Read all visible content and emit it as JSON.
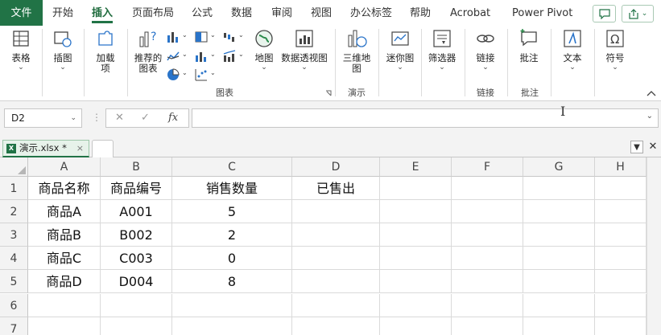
{
  "menu": {
    "file": "文件",
    "tabs": [
      "开始",
      "插入",
      "页面布局",
      "公式",
      "数据",
      "审阅",
      "视图",
      "办公标签",
      "帮助",
      "Acrobat",
      "Power Pivot"
    ],
    "active_tab": "插入"
  },
  "ribbon": {
    "table": "表格",
    "illustrations": "插图",
    "addins": "加载\n项",
    "recommended_charts": "推荐的\n图表",
    "maps": "地图",
    "pivot_chart": "数据透视图",
    "charts_group": "图表",
    "3d_map": "三维地\n图",
    "tours_group": "演示",
    "sparklines": "迷你图",
    "filters": "筛选器",
    "link": "链接",
    "links_group": "链接",
    "comment": "批注",
    "comments_group": "批注",
    "text": "文本",
    "symbols": "符号"
  },
  "formula_bar": {
    "name_box": "D2",
    "formula": ""
  },
  "workbook": {
    "tab_name": "演示.xlsx *"
  },
  "columns": [
    "A",
    "B",
    "C",
    "D",
    "E",
    "F",
    "G",
    "H"
  ],
  "rows": [
    "1",
    "2",
    "3",
    "4",
    "5",
    "6",
    "7"
  ],
  "cells": [
    [
      "商品名称",
      "商品编号",
      "销售数量",
      "已售出",
      "",
      "",
      "",
      ""
    ],
    [
      "商品A",
      "A001",
      "5",
      "",
      "",
      "",
      "",
      ""
    ],
    [
      "商品B",
      "B002",
      "2",
      "",
      "",
      "",
      "",
      ""
    ],
    [
      "商品C",
      "C003",
      "0",
      "",
      "",
      "",
      "",
      ""
    ],
    [
      "商品D",
      "D004",
      "8",
      "",
      "",
      "",
      "",
      ""
    ],
    [
      "",
      "",
      "",
      "",
      "",
      "",
      "",
      ""
    ],
    [
      "",
      "",
      "",
      "",
      "",
      "",
      "",
      ""
    ]
  ],
  "colors": {
    "accent": "#217346"
  }
}
